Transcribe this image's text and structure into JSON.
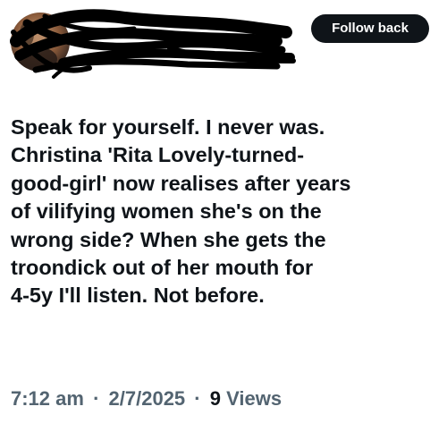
{
  "header": {
    "follow_button_label": "Follow back"
  },
  "tweet": {
    "lines": [
      "Speak for yourself. I never was.",
      "Christina 'Rita Lovely-turned-",
      "good-girl' now realises after years",
      "of vilifying women she's on the",
      "wrong side? When she gets the",
      "troondick out of her mouth for",
      "4-5y I'll listen. Not before."
    ]
  },
  "meta": {
    "time": "7:12 am",
    "separator": "·",
    "date": "2/7/2025",
    "views_count": "9",
    "views_label": "Views"
  }
}
